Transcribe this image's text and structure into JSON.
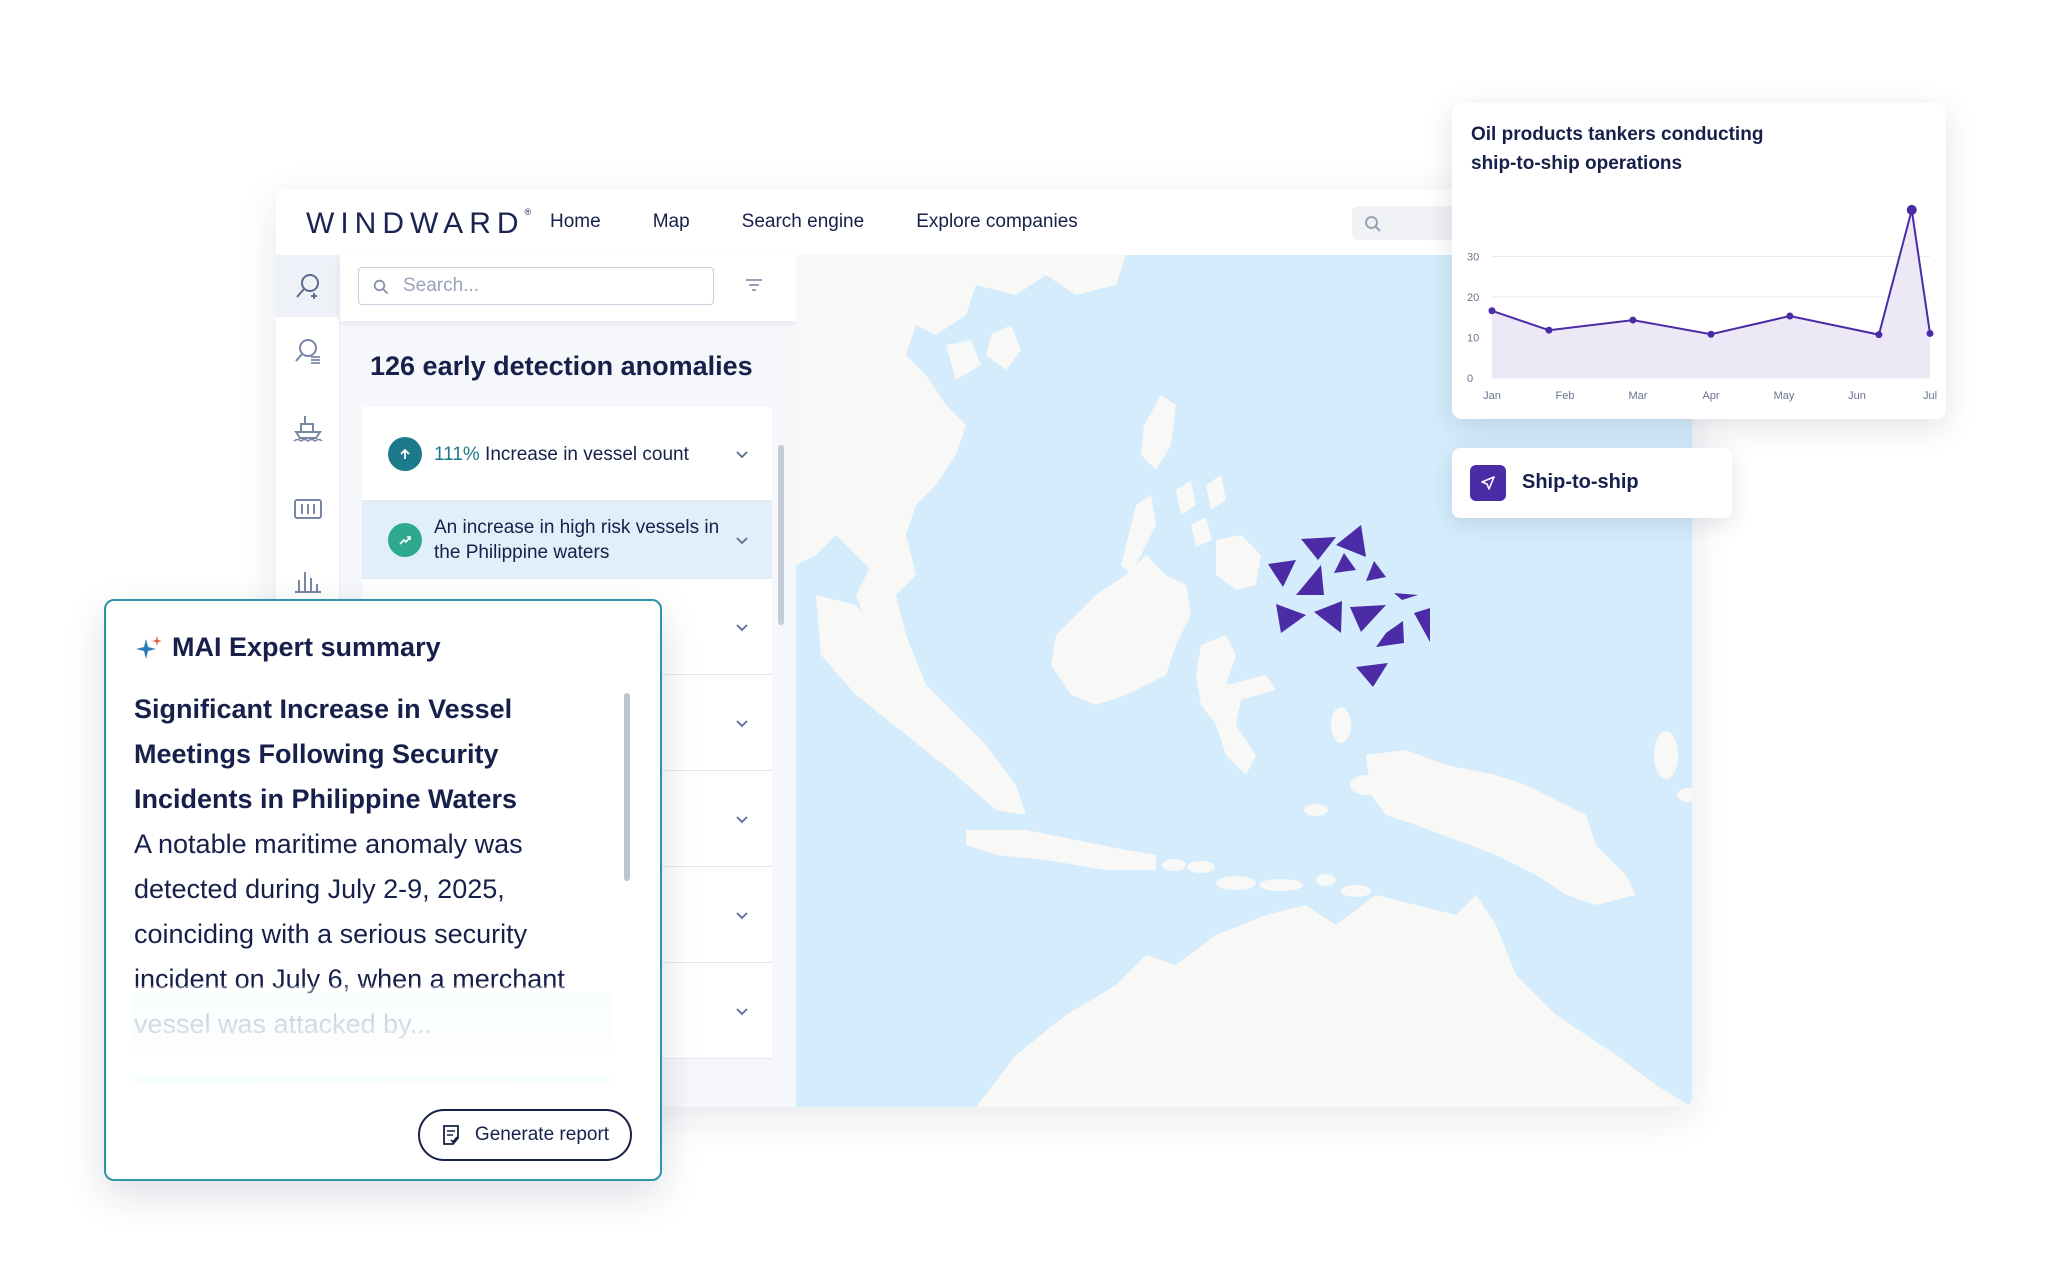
{
  "brand": {
    "logo": "WINDWARD",
    "logo_mark": "®"
  },
  "nav": {
    "items": [
      "Home",
      "Map",
      "Search engine",
      "Explore companies"
    ]
  },
  "panel": {
    "search_placeholder": "Search...",
    "title": "126 early detection anomalies",
    "items": [
      {
        "highlight": "111%",
        "label": " Increase in vessel count",
        "badge_color": "#1c7a8c",
        "icon": "arrow-up-icon"
      },
      {
        "highlight": "",
        "label": "An increase in high risk vessels in the Philippine waters",
        "badge_color": "#2fa890",
        "icon": "trend-up-icon"
      }
    ]
  },
  "chart_card": {
    "title": "Oil products tankers conducting ship-to-ship operations",
    "chart_data": {
      "type": "area",
      "x": [
        "Jan",
        "Feb",
        "Mar",
        "Apr",
        "May",
        "Jun",
        "Jul"
      ],
      "yticks": [
        0,
        10,
        20,
        30
      ],
      "ylim": [
        0,
        30
      ],
      "series": [
        {
          "points": [
            [
              0,
              16.6
            ],
            [
              0.78,
              11.8
            ],
            [
              1.93,
              14.3
            ],
            [
              3.0,
              10.8
            ],
            [
              4.08,
              15.3
            ],
            [
              5.3,
              10.7
            ],
            [
              5.75,
              41.5
            ],
            [
              6.0,
              11.0
            ]
          ]
        }
      ],
      "accent": "#4b2ca6",
      "fill": "#ece8f6"
    }
  },
  "pill": {
    "label": "Ship-to-ship",
    "icon": "cursor-icon"
  },
  "summary": {
    "title": "MAI Expert summary",
    "heading": "Significant Increase in Vessel Meetings Following Security Incidents in Philippine Waters",
    "body": "A notable maritime anomaly was detected during July 2-9, 2025, coinciding with a serious security incident on July 6, when a merchant vessel was attacked by...",
    "button": "Generate report"
  },
  "colors": {
    "navy": "#16204a",
    "purple": "#4b2ca6",
    "sea": "#d4ecfb",
    "land": "#f8f8f6",
    "teal": "#2d95a8"
  }
}
